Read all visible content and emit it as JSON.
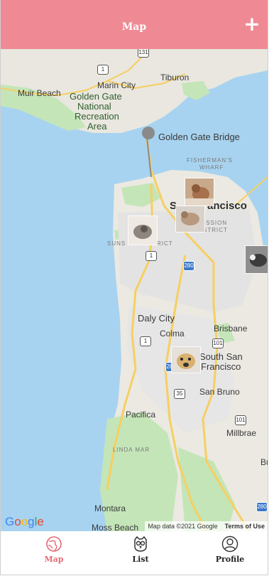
{
  "header": {
    "title": "Map",
    "add_label": "+"
  },
  "map": {
    "labels": {
      "muir_beach": "Muir Beach",
      "marin_city": "Marin City",
      "tiburon": "Tiburon",
      "golden_gate_area_1": "Golden Gate",
      "golden_gate_area_2": "National",
      "golden_gate_area_3": "Recreation",
      "golden_gate_area_4": "Area",
      "golden_gate_bridge": "Golden Gate Bridge",
      "fishermans_wharf_1": "FISHERMAN'S",
      "fishermans_wharf_2": "WHARF",
      "san_francisco_1": "S",
      "san_francisco_2": "ancisco",
      "mission_1": "ISSION",
      "mission_2": "STRICT",
      "sunset": "SUNS",
      "sunset_2": "RICT",
      "daly_city": "Daly City",
      "colma": "Colma",
      "brisbane": "Brisbane",
      "south_sf_1": "South San",
      "south_sf_2": "Francisco",
      "san_bruno": "San Bruno",
      "pacifica": "Pacifica",
      "millbrae": "Millbrae",
      "linda_mar": "LINDA MAR",
      "montara": "Montara",
      "moss_beach": "Moss Beach",
      "bu": "Bu"
    },
    "highways": {
      "h131": "131",
      "h1_north": "1",
      "h1_mid": "1",
      "h280_a": "280",
      "h1_south": "1",
      "h101_a": "101",
      "h280_b": "280",
      "h35": "35",
      "h101_b": "101",
      "h280_c": "280"
    },
    "attribution": {
      "data": "Map data ©2021 Google",
      "terms": "Terms of Use"
    },
    "logo_letters": [
      "G",
      "o",
      "o",
      "g",
      "l",
      "e"
    ]
  },
  "tabs": [
    {
      "label": "Map",
      "icon": "globe-icon",
      "active": true
    },
    {
      "label": "List",
      "icon": "owl-icon",
      "active": false
    },
    {
      "label": "Profile",
      "icon": "person-icon",
      "active": false
    }
  ],
  "colors": {
    "header": "#ef8a94",
    "active_tab": "#e36a76",
    "water": "#a7d3f0",
    "land": "#eceae3",
    "park": "#bfe3b4"
  }
}
